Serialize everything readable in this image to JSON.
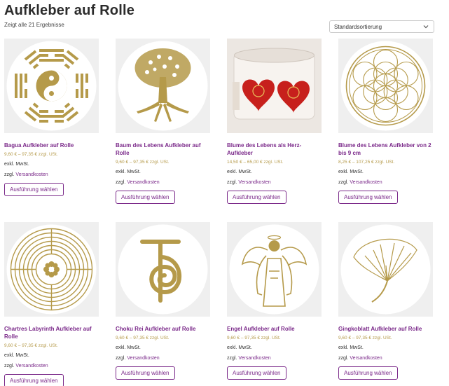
{
  "page": {
    "title": "Aufkleber auf Rolle",
    "result_count": "Zeigt alle 21 Ergebnisse",
    "sort_selected": "Standardsortierung"
  },
  "colors": {
    "accent": "#7b2a8a",
    "gold": "#b59a4a",
    "thumb_bg": "#efefef"
  },
  "products": [
    {
      "title": "Bagua Aufkleber auf Rolle",
      "price": "9,60 € – 97,35 € zzgl. USt.",
      "tax": "exkl. MwSt.",
      "ship_prefix": "zzgl.",
      "ship_link": "Versandkosten",
      "button": "Ausführung wählen",
      "icon": "bagua-yin-yang-icon"
    },
    {
      "title": "Baum des Lebens Aufkleber auf Rolle",
      "price": "9,60 € – 97,35 € zzgl. USt.",
      "tax": "exkl. MwSt.",
      "ship_prefix": "zzgl.",
      "ship_link": "Versandkosten",
      "button": "Ausführung wählen",
      "icon": "tree-of-life-icon"
    },
    {
      "title": "Blume des Lebens als Herz-Aufkleber",
      "price": "14,50 € – 65,00 € zzgl. USt.",
      "tax": "exkl. MwSt.",
      "ship_prefix": "zzgl.",
      "ship_link": "Versandkosten",
      "button": "Ausführung wählen",
      "icon": "heart-sticker-roll-icon"
    },
    {
      "title": "Blume des Lebens Aufkleber von 2 bis 9 cm",
      "price": "8,25 € – 107,25 € zzgl. USt.",
      "tax": "exkl. MwSt.",
      "ship_prefix": "zzgl.",
      "ship_link": "Versandkosten",
      "button": "Ausführung wählen",
      "icon": "flower-of-life-icon"
    },
    {
      "title": "Chartres Labyrinth Aufkleber auf Rolle",
      "price": "9,60 € – 97,35 € zzgl. USt.",
      "tax": "exkl. MwSt.",
      "ship_prefix": "zzgl.",
      "ship_link": "Versandkosten",
      "button": "Ausführung wählen",
      "icon": "labyrinth-icon"
    },
    {
      "title": "Choku Rei Aufkleber auf Rolle",
      "price": "9,60 € – 97,35 € zzgl. USt.",
      "tax": "exkl. MwSt.",
      "ship_prefix": "zzgl.",
      "ship_link": "Versandkosten",
      "button": "Ausführung wählen",
      "icon": "choku-rei-icon"
    },
    {
      "title": "Engel Aufkleber auf Rolle",
      "price": "9,60 € – 97,35 € zzgl. USt.",
      "tax": "exkl. MwSt.",
      "ship_prefix": "zzgl.",
      "ship_link": "Versandkosten",
      "button": "Ausführung wählen",
      "icon": "angel-icon"
    },
    {
      "title": "Gingkoblatt Aufkleber auf Rolle",
      "price": "9,60 € – 97,35 € zzgl. USt.",
      "tax": "exkl. MwSt.",
      "ship_prefix": "zzgl.",
      "ship_link": "Versandkosten",
      "button": "Ausführung wählen",
      "icon": "ginkgo-leaf-icon"
    }
  ]
}
